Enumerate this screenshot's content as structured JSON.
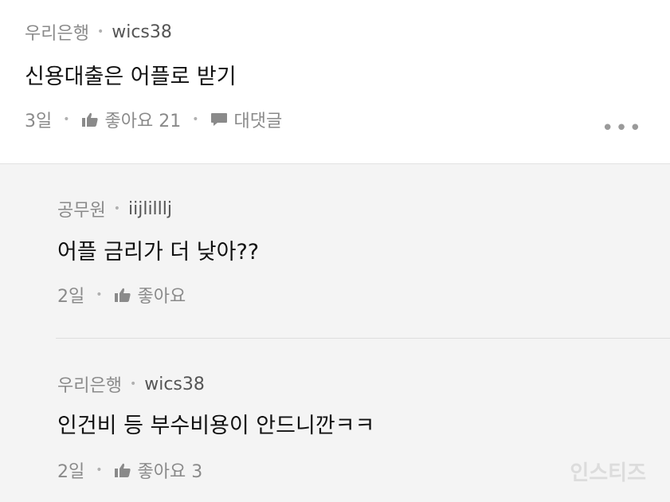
{
  "post": {
    "bank": "우리은행",
    "username": "wics38",
    "text": "신용대출은 어플로 받기",
    "time": "3일",
    "like_label": "좋아요 21",
    "reply_label": "대댓글",
    "more_icon": "more-icon"
  },
  "replies": [
    {
      "bank": "공무원",
      "username": "iijlilllj",
      "text": "어플 금리가 더 낮아??",
      "time": "2일",
      "like_label": "좋아요"
    },
    {
      "bank": "우리은행",
      "username": "wics38",
      "text": "인건비 등 부수비용이 안드니깐ㅋㅋ",
      "time": "2일",
      "like_label": "좋아요 3"
    }
  ],
  "watermark": "인스티즈"
}
